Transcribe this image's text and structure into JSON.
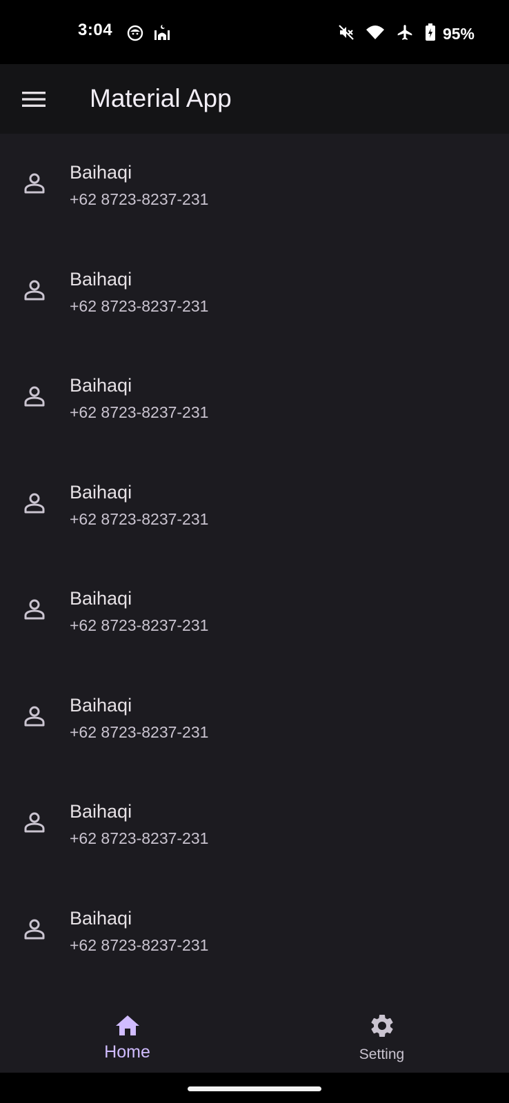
{
  "status_bar": {
    "time": "3:04",
    "battery": "95%",
    "icons_left": [
      "face-notification-icon",
      "mosque-notification-icon"
    ],
    "icons_right": [
      "mute-icon",
      "wifi-icon",
      "airplane-mode-icon",
      "battery-charging-icon"
    ]
  },
  "app_bar": {
    "title": "Material App",
    "menu_icon": "menu-icon"
  },
  "contacts": [
    {
      "name": "Baihaqi",
      "phone": "+62 8723-8237-231"
    },
    {
      "name": "Baihaqi",
      "phone": "+62 8723-8237-231"
    },
    {
      "name": "Baihaqi",
      "phone": "+62 8723-8237-231"
    },
    {
      "name": "Baihaqi",
      "phone": "+62 8723-8237-231"
    },
    {
      "name": "Baihaqi",
      "phone": "+62 8723-8237-231"
    },
    {
      "name": "Baihaqi",
      "phone": "+62 8723-8237-231"
    },
    {
      "name": "Baihaqi",
      "phone": "+62 8723-8237-231"
    },
    {
      "name": "Baihaqi",
      "phone": "+62 8723-8237-231"
    }
  ],
  "bottom_nav": {
    "items": [
      {
        "label": "Home",
        "icon": "home-icon",
        "selected": true
      },
      {
        "label": "Setting",
        "icon": "gear-icon",
        "selected": false
      }
    ]
  },
  "colors": {
    "app_bar": "#141416",
    "background": "#1c1b20",
    "accent": "#d0bcff",
    "text_primary": "#e6e1e5",
    "text_secondary": "#cac4d0"
  }
}
